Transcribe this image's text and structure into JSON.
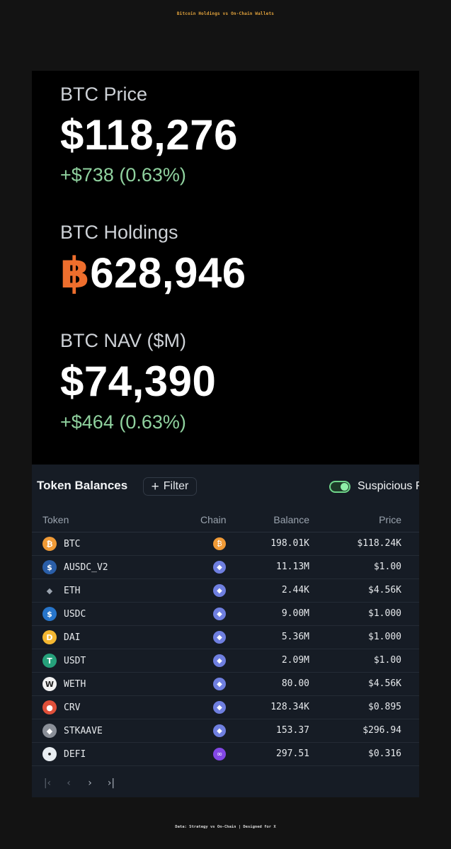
{
  "header": {
    "title": "Bitcoin Holdings vs On-Chain Wallets"
  },
  "stats": {
    "price": {
      "label": "BTC Price",
      "value": "$118,276",
      "change": "+$738 (0.63%)"
    },
    "holdings": {
      "label": "BTC Holdings",
      "symbol": "฿",
      "value": "628,946"
    },
    "nav": {
      "label": "BTC NAV ($M)",
      "value": "$74,390",
      "change": "+$464 (0.63%)"
    }
  },
  "token_panel": {
    "title": "Token Balances",
    "filter_label": "Filter",
    "toggle_label": "Suspicious F",
    "toggle_on": true,
    "columns": {
      "token": "Token",
      "chain": "Chain",
      "balance": "Balance",
      "price": "Price"
    },
    "rows": [
      {
        "token": "BTC",
        "icon": "bitcoin-icon",
        "icon_glyph": "₿",
        "icon_color": "#f09a36",
        "chain": "bitcoin-chain-icon",
        "chain_glyph": "₿",
        "chain_color": "#f09a36",
        "balance": "198.01K",
        "price": "$118.24K"
      },
      {
        "token": "AUSDC_V2",
        "icon": "ausdc-icon",
        "icon_glyph": "$",
        "icon_color": "#2a5ea8",
        "chain": "ethereum-chain-icon",
        "chain_glyph": "◆",
        "chain_color": "#6f7fe0",
        "balance": "11.13M",
        "price": "$1.00"
      },
      {
        "token": "ETH",
        "icon": "ethereum-icon",
        "icon_glyph": "◆",
        "icon_color": "transparent",
        "chain": "ethereum-chain-icon",
        "chain_glyph": "◆",
        "chain_color": "#6f7fe0",
        "balance": "2.44K",
        "price": "$4.56K"
      },
      {
        "token": "USDC",
        "icon": "usdc-icon",
        "icon_glyph": "$",
        "icon_color": "#2775ca",
        "chain": "ethereum-chain-icon",
        "chain_glyph": "◆",
        "chain_color": "#6f7fe0",
        "balance": "9.00M",
        "price": "$1.000"
      },
      {
        "token": "DAI",
        "icon": "dai-icon",
        "icon_glyph": "D",
        "icon_color": "#f4b731",
        "chain": "ethereum-chain-icon",
        "chain_glyph": "◆",
        "chain_color": "#6f7fe0",
        "balance": "5.36M",
        "price": "$1.000"
      },
      {
        "token": "USDT",
        "icon": "tether-icon",
        "icon_glyph": "T",
        "icon_color": "#26a17b",
        "chain": "ethereum-chain-icon",
        "chain_glyph": "◆",
        "chain_color": "#6f7fe0",
        "balance": "2.09M",
        "price": "$1.00"
      },
      {
        "token": "WETH",
        "icon": "weth-icon",
        "icon_glyph": "W",
        "icon_color": "#f2f2f2",
        "chain": "ethereum-chain-icon",
        "chain_glyph": "◆",
        "chain_color": "#6f7fe0",
        "balance": "80.00",
        "price": "$4.56K"
      },
      {
        "token": "CRV",
        "icon": "curve-icon",
        "icon_glyph": "●",
        "icon_color": "#e0503a",
        "chain": "ethereum-chain-icon",
        "chain_glyph": "◆",
        "chain_color": "#6f7fe0",
        "balance": "128.34K",
        "price": "$0.895"
      },
      {
        "token": "STKAAVE",
        "icon": "stkaave-icon",
        "icon_glyph": "◆",
        "icon_color": "#8a8f98",
        "chain": "ethereum-chain-icon",
        "chain_glyph": "◆",
        "chain_color": "#6f7fe0",
        "balance": "153.37",
        "price": "$296.94"
      },
      {
        "token": "DEFI",
        "icon": "defi-icon",
        "icon_glyph": "•",
        "icon_color": "#e9eef2",
        "chain": "polygon-chain-icon",
        "chain_glyph": "∞",
        "chain_color": "#8247e5",
        "balance": "297.51",
        "price": "$0.316"
      }
    ],
    "pager": [
      "first-page-icon",
      "prev-page-icon",
      "next-page-icon",
      "last-page-icon"
    ]
  },
  "footer": {
    "text": "Data: Strategy vs On-Chain | Designed for X"
  }
}
